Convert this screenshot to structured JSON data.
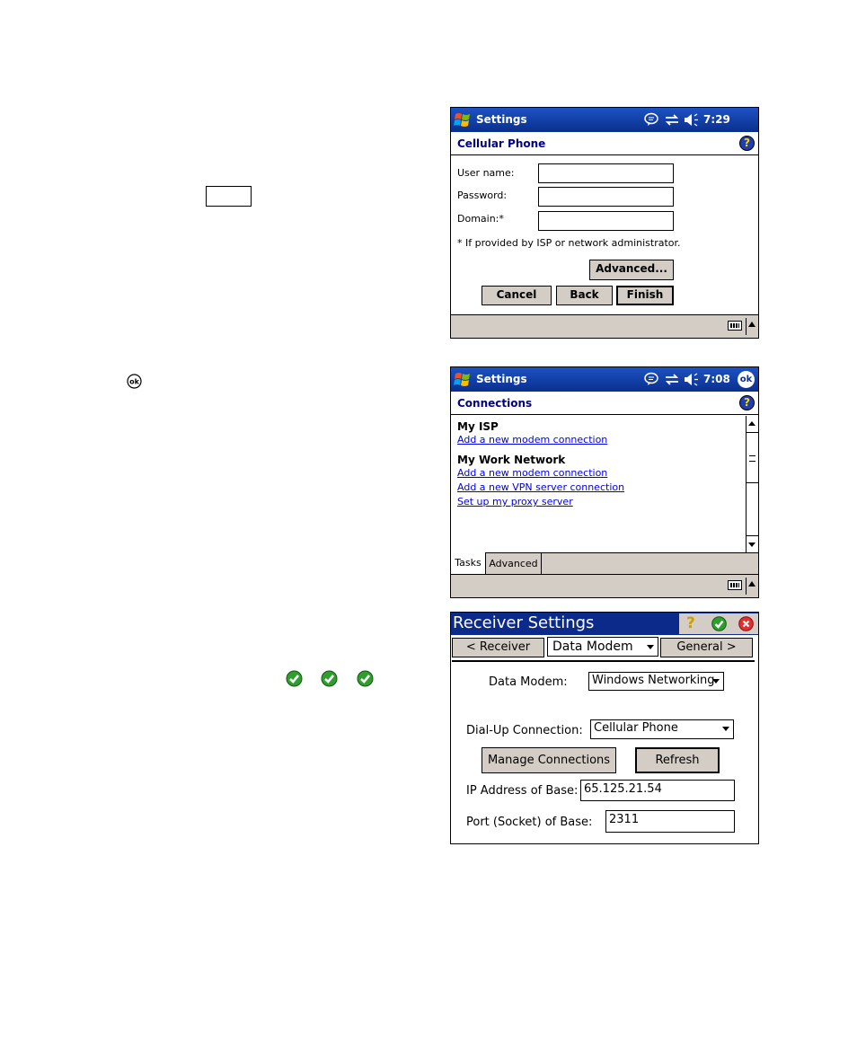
{
  "cellular_screen": {
    "title": "Settings",
    "clock": "7:29",
    "header": "Cellular Phone",
    "username_label": "User name:",
    "password_label": "Password:",
    "domain_label": "Domain:*",
    "note": "* If provided by ISP or network administrator.",
    "advanced_button": "Advanced...",
    "cancel_button": "Cancel",
    "back_button": "Back",
    "finish_button": "Finish"
  },
  "connections_screen": {
    "title": "Settings",
    "clock": "7:08",
    "ok_label": "ok",
    "header": "Connections",
    "group1": "My ISP",
    "group1_link1": "Add a new modem connection",
    "group2": "My Work Network",
    "group2_link1": "Add a new modem connection",
    "group2_link2": "Add a new VPN server connection",
    "group2_link3": "Set up my proxy server",
    "tabs": [
      "Tasks",
      "Advanced"
    ]
  },
  "receiver_screen": {
    "title": "Receiver Settings",
    "prev_button": "< Receiver",
    "section_select": "Data Modem",
    "next_button": "General >",
    "data_modem_label": "Data Modem:",
    "data_modem_value": "Windows Networking",
    "dialup_label": "Dial-Up Connection:",
    "dialup_value": "Cellular Phone",
    "manage_button": "Manage Connections",
    "refresh_button": "Refresh",
    "ip_label": "IP Address of Base:",
    "ip_value": "65.125.21.54",
    "port_label": "Port (Socket) of Base:",
    "port_value": "2311"
  },
  "colors": {
    "titlebar": "#0e3a9e",
    "header_text": "#00008b",
    "button_face": "#d4cdc5",
    "link": "#0000ee",
    "ok_green": "#2e9e2e",
    "close_red": "#e23030"
  }
}
